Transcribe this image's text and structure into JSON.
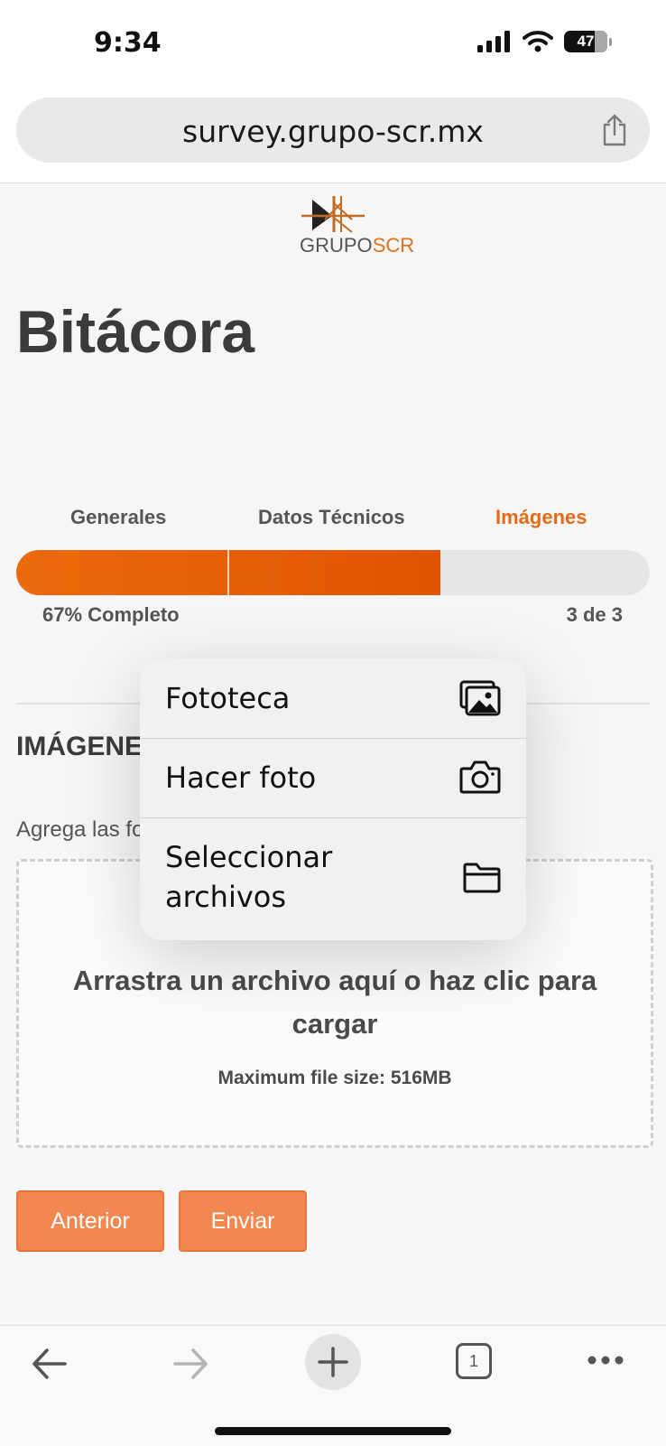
{
  "status": {
    "time": "9:34",
    "battery": "47"
  },
  "browser": {
    "url": "survey.grupo-scr.mx"
  },
  "logo": {
    "part1": "GRUPO",
    "part2": "SCR"
  },
  "page": {
    "title": "Bitácora"
  },
  "steps": {
    "items": [
      "Generales",
      "Datos Técnicos",
      "Imágenes"
    ],
    "active": "Imágenes"
  },
  "progress": {
    "percent": 67,
    "text": "67% Completo",
    "count": "3 de 3"
  },
  "section": {
    "heading": "IMÁGENES",
    "hint": "Agrega las fotos"
  },
  "upload": {
    "instruction": "Arrastra un archivo aquí o haz clic para cargar",
    "max_size": "Maximum file size: 516MB"
  },
  "buttons": {
    "previous": "Anterior",
    "submit": "Enviar"
  },
  "picker_menu": {
    "items": [
      {
        "label": "Fototeca",
        "icon": "photo-library-icon"
      },
      {
        "label": "Hacer foto",
        "icon": "camera-icon"
      },
      {
        "label": "Seleccionar archivos",
        "icon": "folder-icon"
      }
    ]
  },
  "toolbar": {
    "tab_count": "1"
  },
  "colors": {
    "accent": "#e46a1a",
    "button": "#f2874f",
    "progress": "#e05300"
  }
}
